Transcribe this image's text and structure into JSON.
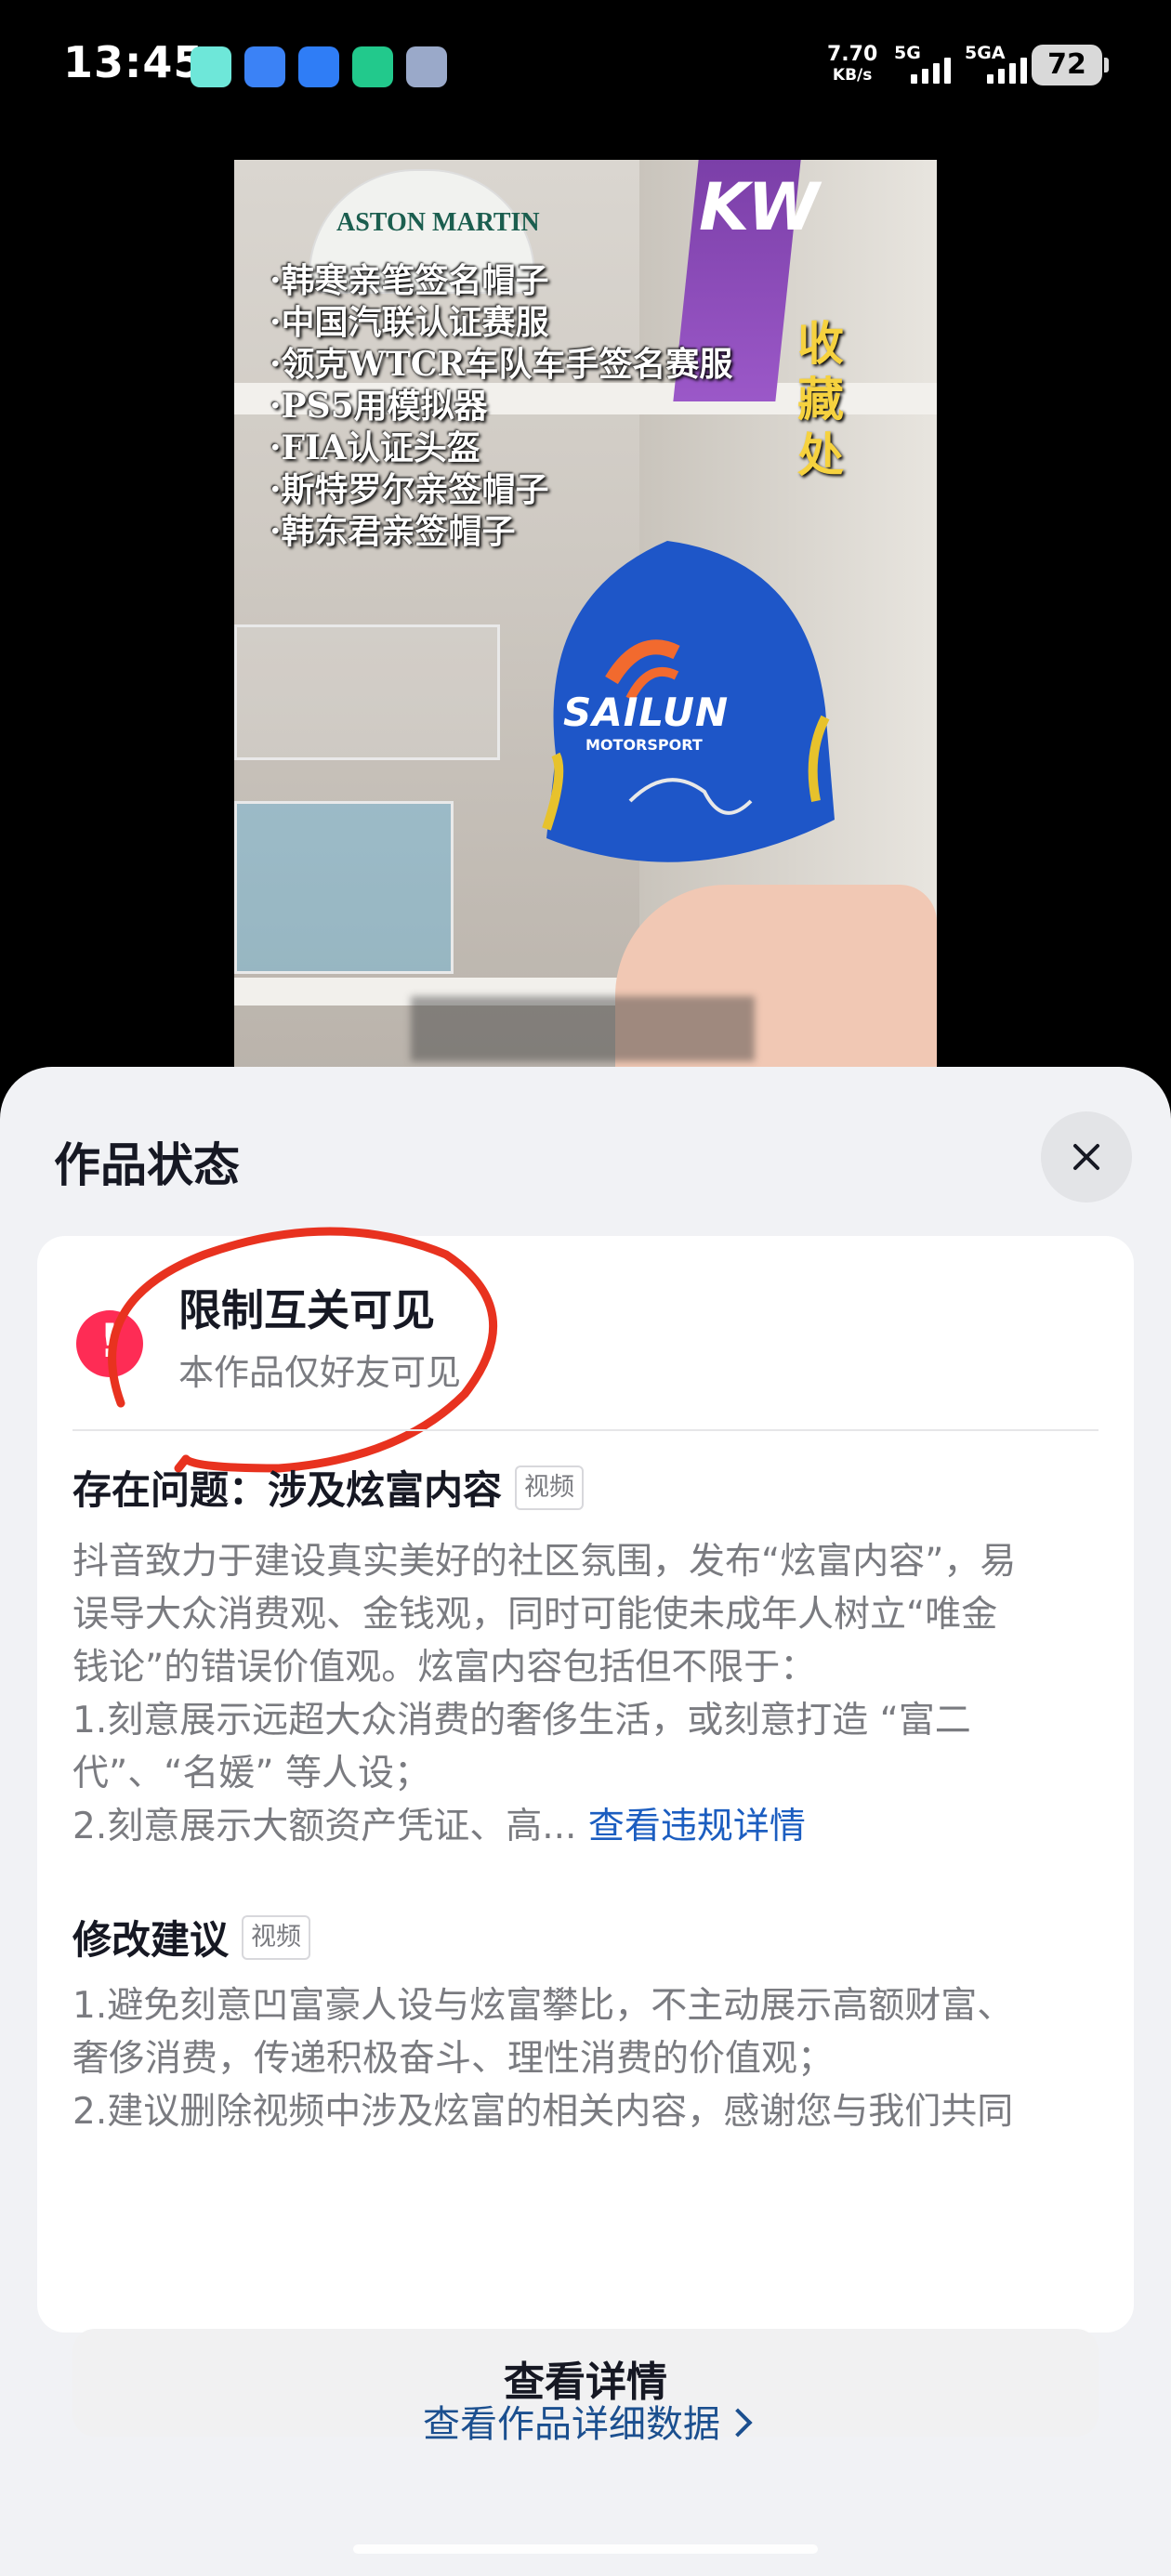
{
  "status_bar": {
    "time": "13:45",
    "net_speed_value": "7.70",
    "net_speed_unit": "KB/s",
    "sig1_label": "5G",
    "sig2_label": "5GA",
    "battery": "72",
    "app_icon_colors": [
      "#6ee7d9",
      "#3b82f6",
      "#2f7df6",
      "#22c98c",
      "#9aa9c9"
    ]
  },
  "video": {
    "overlay_list": [
      "·韩寒亲笔签名帽子",
      "·中国汽联认证赛服",
      "·领克WTCR车队车手签名赛服",
      "·PS5用模拟器",
      "·FIA认证头盔",
      "·斯特罗尔亲签帽子",
      "·韩东君亲签帽子"
    ],
    "side_label": "收藏处",
    "cap_brand": "SAILUN",
    "cap_sub": "MOTORSPORT",
    "white_hat_text": "ASTON MARTIN",
    "flag_text": "KW"
  },
  "sheet": {
    "title": "作品状态",
    "status_title": "限制互关可见",
    "status_sub": "本作品仅好友可见",
    "issue_title": "存在问题：涉及炫富内容",
    "issue_tag": "视频",
    "issue_lines": [
      "抖音致力于建设真实美好的社区氛围，发布“炫富内容”，易",
      "误导大众消费观、金钱观，同时可能使未成年人树立“唯金",
      "钱论”的错误价值观。炫富内容包括但不限于：",
      "1.刻意展示远超大众消费的奢侈生活，或刻意打造 “富二",
      "代”、“名媛” 等人设；",
      "2.刻意展示大额资产凭证、高..."
    ],
    "issue_link": "查看违规详情",
    "suggest_title": "修改建议",
    "suggest_tag": "视频",
    "suggest_lines": [
      "1.避免刻意凹富豪人设与炫富攀比，不主动展示高额财富、",
      "奢侈消费，传递积极奋斗、理性消费的价值观；",
      "2.建议删除视频中涉及炫富的相关内容，感谢您与我们共同"
    ],
    "detail_button": "查看详情",
    "data_link": "查看作品详细数据"
  },
  "colors": {
    "accent_red": "#fe2c55",
    "annotation_red": "#e8321f",
    "link_blue": "#1b5dc0"
  }
}
